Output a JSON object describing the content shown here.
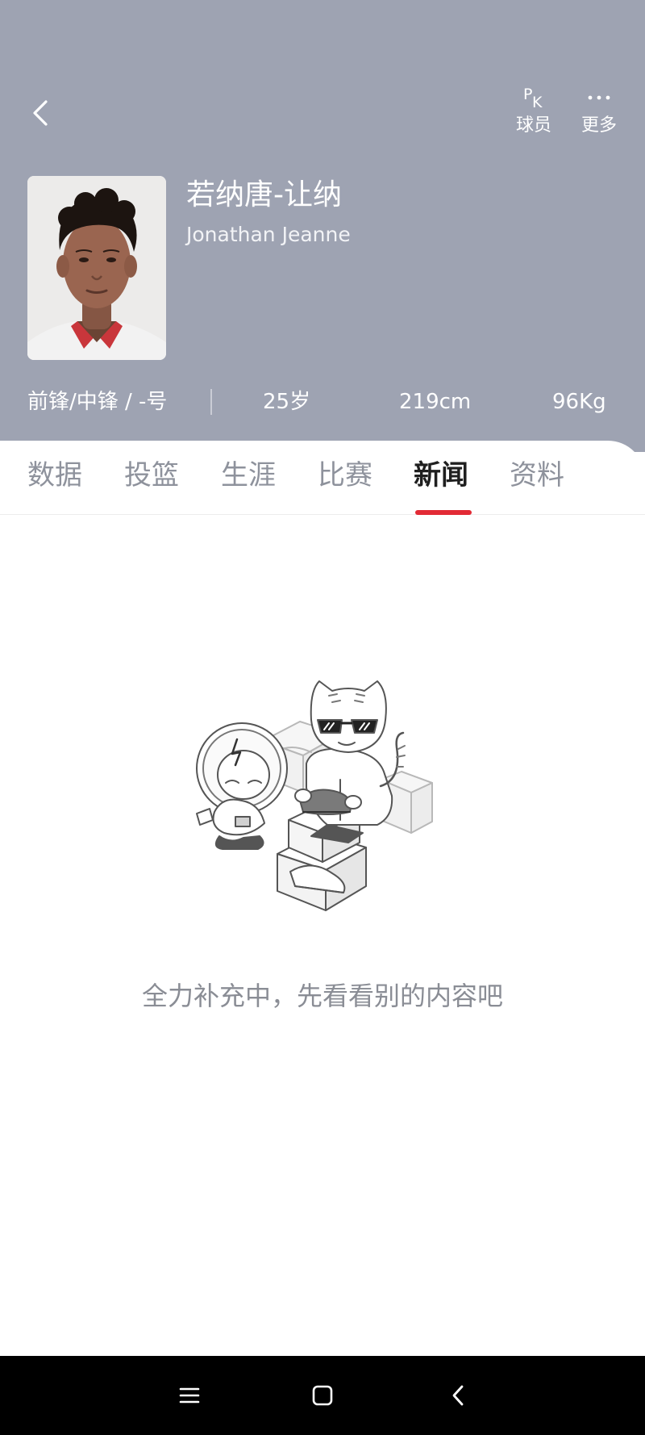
{
  "header": {
    "background_color": "#9ea3b2",
    "back_icon": "chevron-left-icon",
    "actions": [
      {
        "icon": "pk-icon",
        "icon_text_p": "P",
        "icon_text_k": "K",
        "label": "球员"
      },
      {
        "icon": "more-dots-icon",
        "label": "更多"
      }
    ]
  },
  "player": {
    "name_cn": "若纳唐-让纳",
    "name_en": "Jonathan Jeanne",
    "position": "前锋/中锋 / -号",
    "age": "25岁",
    "height": "219cm",
    "weight": "96Kg"
  },
  "tabs": [
    {
      "label": "数据",
      "active": false
    },
    {
      "label": "投篮",
      "active": false
    },
    {
      "label": "生涯",
      "active": false
    },
    {
      "label": "比赛",
      "active": false
    },
    {
      "label": "新闻",
      "active": true
    },
    {
      "label": "资料",
      "active": false
    }
  ],
  "accent_color": "#e22a35",
  "empty_state": {
    "illustration": "cartoon-cat-and-astronaut-with-shoe-boxes",
    "message": "全力补充中，先看看别的内容吧"
  },
  "system_nav": {
    "icons": [
      "menu-icon",
      "home-square-icon",
      "back-triangle-icon"
    ]
  }
}
